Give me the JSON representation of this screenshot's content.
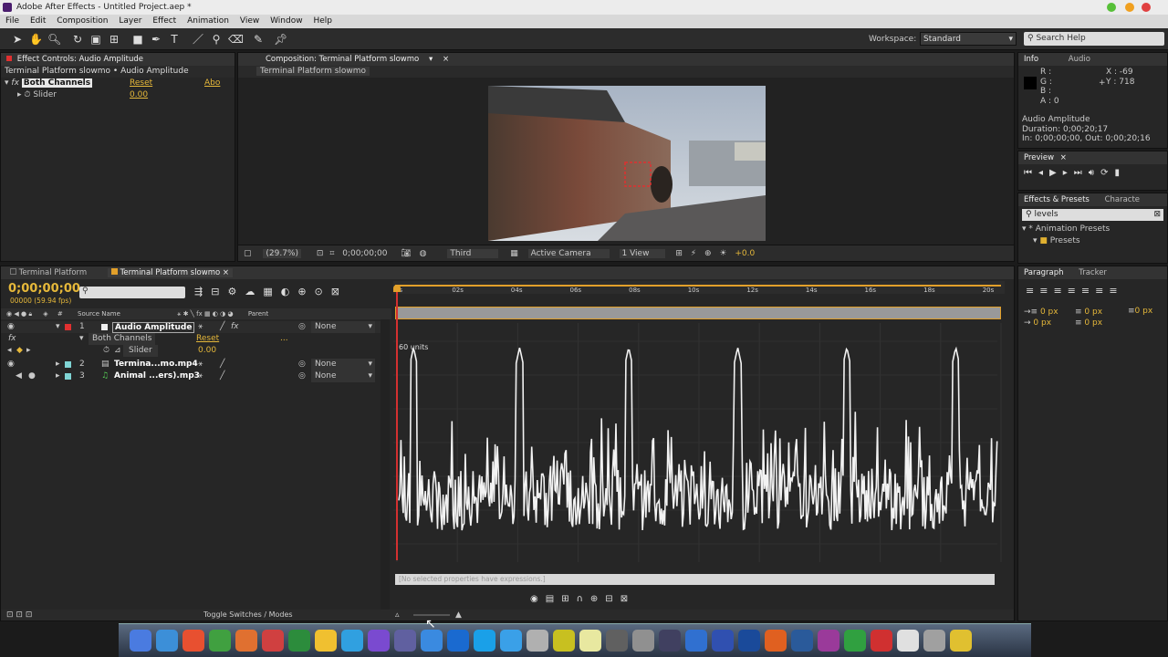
{
  "app": {
    "title": "Adobe After Effects - Untitled Project.aep *"
  },
  "menu": [
    "File",
    "Edit",
    "Composition",
    "Layer",
    "Effect",
    "Animation",
    "View",
    "Window",
    "Help"
  ],
  "toolbar": {
    "workspace_label": "Workspace:",
    "workspace_value": "Standard",
    "search_placeholder": "Search Help"
  },
  "effect_controls": {
    "tab": "Effect Controls: Audio Amplitude",
    "subtitle": "Terminal Platform slowmo • Audio Amplitude",
    "effect_name": "Both Channels",
    "reset_label": "Reset",
    "about_label": "Abo",
    "param_name": "Slider",
    "param_value": "0.00"
  },
  "composition": {
    "tab": "Composition: Terminal Platform slowmo",
    "subtab": "Terminal Platform slowmo",
    "zoom": "(29.7%)",
    "timecode": "0;00;00;00",
    "resolution": "Third",
    "camera": "Active Camera",
    "view": "1 View",
    "exposure": "+0.0"
  },
  "info": {
    "tabs": [
      "Info",
      "Audio"
    ],
    "r": "R :",
    "g": "G :",
    "b": "B :",
    "a": "A : 0",
    "x": "X : -69",
    "y": "Y : 718",
    "layer_name": "Audio Amplitude",
    "duration": "Duration: 0;00;20;17",
    "in_out": "In: 0;00;00;00, Out: 0;00;20;16"
  },
  "preview": {
    "tab": "Preview"
  },
  "effects_presets": {
    "tabs": [
      "Effects & Presets",
      "Characte"
    ],
    "search_value": "levels",
    "tree": [
      "* Animation Presets",
      "Presets"
    ]
  },
  "paragraph": {
    "tabs": [
      "Paragraph",
      "Tracker"
    ],
    "indent_values": [
      "0 px",
      "0 px",
      "0 px",
      "0 px",
      "0 px"
    ]
  },
  "timeline": {
    "tabs": [
      "Terminal Platform",
      "Terminal Platform slowmo"
    ],
    "timecode": "0;00;00;00",
    "frames": "00000 (59.94 fps)",
    "col_source": "Source Name",
    "col_parent": "Parent",
    "layers": [
      {
        "num": "1",
        "name": "Audio Amplitude",
        "parent": "None",
        "color": "#e03030"
      },
      {
        "num": "2",
        "name": "Termina...mo.mp4",
        "parent": "None",
        "color": "#7fd4d4"
      },
      {
        "num": "3",
        "name": "Animal ...ers).mp3",
        "parent": "None",
        "color": "#7fd4d4"
      }
    ],
    "effect_row": "Both Channels",
    "effect_reset": "Reset",
    "slider_row": "Slider",
    "slider_value": "0.00",
    "toggle_label": "Toggle Switches / Modes",
    "ruler": [
      "0s",
      "02s",
      "04s",
      "06s",
      "08s",
      "10s",
      "12s",
      "14s",
      "16s",
      "18s",
      "20s"
    ],
    "graph_unit": "60 units",
    "expr_hint": "[No selected properties have expressions.]"
  },
  "graph_data": {
    "peaks_x": [
      0.5,
      4.1,
      7.8,
      11.5,
      15.2,
      18.9
    ],
    "peak_value": 58,
    "baseline": 5
  },
  "colors": {
    "accent": "#e6b83a",
    "selection": "#e2a02a",
    "playhead": "#d43030"
  }
}
